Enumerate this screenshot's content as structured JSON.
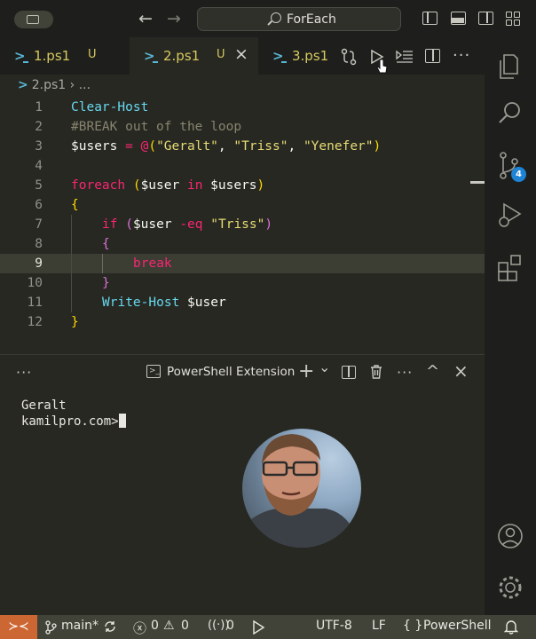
{
  "titlebar": {
    "search_label": "ForEach",
    "back_arrow": "←",
    "forward_arrow": "→"
  },
  "tabs": [
    {
      "name": "1.ps1",
      "status": "U"
    },
    {
      "name": "2.ps1",
      "status": "U",
      "active": true
    },
    {
      "name": "3.ps1",
      "status": ""
    }
  ],
  "tab_close": "×",
  "breadcrumb": {
    "file": "2.ps1",
    "separator": "›",
    "more": "..."
  },
  "editor": {
    "line_numbers": [
      "1",
      "2",
      "3",
      "4",
      "5",
      "6",
      "7",
      "8",
      "9",
      "10",
      "11",
      "12"
    ],
    "current_line": 9,
    "lines": {
      "l1": {
        "cmd": "Clear-Host"
      },
      "l2": {
        "comment": "#BREAK out of the loop"
      },
      "l3": {
        "var": "$users",
        "eq": " = ",
        "at": "@",
        "open": "(",
        "s1": "\"Geralt\"",
        "c1": ", ",
        "s2": "\"Triss\"",
        "c2": ", ",
        "s3": "\"Yenefer\"",
        "close": ")"
      },
      "l5": {
        "kw": "foreach",
        "sp": " ",
        "open": "(",
        "var1": "$user",
        "in": " in ",
        "var2": "$users",
        "close": ")"
      },
      "l6": {
        "brace": "{"
      },
      "l7": {
        "kw": "if",
        "sp": " ",
        "open": "(",
        "var": "$user",
        "op": " -eq ",
        "str": "\"Triss\"",
        "close": ")"
      },
      "l8": {
        "brace": "{"
      },
      "l9": {
        "kw": "break"
      },
      "l10": {
        "brace": "}"
      },
      "l11": {
        "cmd": "Write-Host",
        "var": " $user"
      },
      "l12": {
        "brace": "}"
      }
    }
  },
  "panel": {
    "more": "···",
    "title": "PowerShell Extension",
    "add": "+",
    "dropdown": "⌄",
    "up": "^",
    "close": "×"
  },
  "terminal": {
    "lines": [
      "Geralt",
      "kamilpro.com>"
    ]
  },
  "activity": {
    "source_control_badge": "4"
  },
  "statusbar": {
    "remote_icon": "≻≺",
    "branch": "main*",
    "errors": "0",
    "warnings": "0",
    "ports": "0",
    "encoding": "UTF-8",
    "eol": "LF",
    "language_braces": "{ }",
    "language": "PowerShell"
  },
  "colors": {
    "editor_bg": "#272822",
    "chrome_bg": "#1e1f1c",
    "statusbar_bg": "#414339",
    "remote_bg": "#cc6633",
    "badge": "#1d83d4",
    "tab_name": "#d7c95e"
  }
}
